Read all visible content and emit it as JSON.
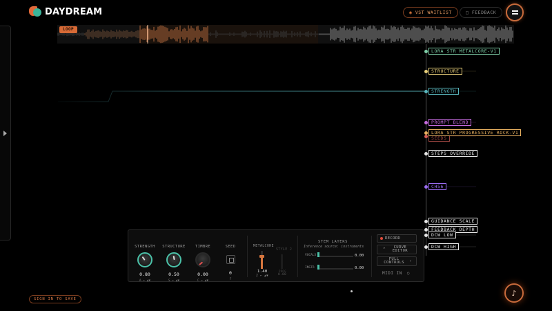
{
  "app": {
    "name": "DAYDREAM"
  },
  "header": {
    "vst_waitlist": "VST WAITLIST",
    "feedback": "FEEDBACK"
  },
  "waveform": {
    "loop_label": "LOOP"
  },
  "tracks": [
    {
      "id": "lora1",
      "label": "LORA STR METALCORE-V1",
      "color": "#7fcfa8"
    },
    {
      "id": "structure",
      "label": "STRUCTURE",
      "color": "#e8cf7a"
    },
    {
      "id": "strength",
      "label": "STRENGTH",
      "color": "#5ab8bf"
    },
    {
      "id": "prompt",
      "label": "PROMPT BLEND",
      "color": "#c66ce0"
    },
    {
      "id": "lora2",
      "label": "LORA STR PROGRESSIVE ROCK-V1",
      "color": "#e8b060"
    },
    {
      "id": "seeds",
      "label": "SEEDS",
      "color": "#d9605a"
    },
    {
      "id": "steps",
      "label": "STEPS OVERRIDE",
      "color": "#e6e6e6"
    },
    {
      "id": "ch56",
      "label": "CH56",
      "color": "#9a6cf0"
    },
    {
      "id": "guidance",
      "label": "GUIDANCE SCALE",
      "color": "#e6e6e6"
    },
    {
      "id": "feedback",
      "label": "FEEDBACK DEPTH",
      "color": "#e6e6e6"
    },
    {
      "id": "dcwlow",
      "label": "DCW LOW",
      "color": "#e6e6e6"
    },
    {
      "id": "dcwhigh",
      "label": "DCW HIGH",
      "color": "#e6e6e6"
    }
  ],
  "panel": {
    "knobs": [
      {
        "title": "STRENGTH",
        "value": "0.80",
        "key": "A ← ▲▼"
      },
      {
        "title": "STRUCTURE",
        "value": "0.50",
        "key": "S ← ▲▼"
      },
      {
        "title": "TIMBRE",
        "value": "0.00",
        "key": "C ← ▲▼"
      },
      {
        "title": "SEED",
        "value": "0",
        "key": "F"
      }
    ],
    "metalcore": {
      "title": "METALCORE",
      "value": "1.40",
      "key": "Z ← ▲▼",
      "level": 0.7
    },
    "style2": {
      "title": "STYLE 2",
      "value": "0.00",
      "sub": "PROG"
    },
    "stems": {
      "title": "STEM LAYERS",
      "subtitle": "Inference source: instruments",
      "rows": [
        {
          "label": "VOCALS",
          "value": "0.00"
        },
        {
          "label": "INSTR",
          "value": "0.00"
        }
      ]
    },
    "buttons": {
      "record": "RECORD",
      "curve_editor": "CURVE EDITOR",
      "full_controls": "FULL CONTROLS",
      "midi_in": "MIDI IN"
    }
  },
  "footer": {
    "sign_in": "SIGN IN TO SAVE"
  }
}
